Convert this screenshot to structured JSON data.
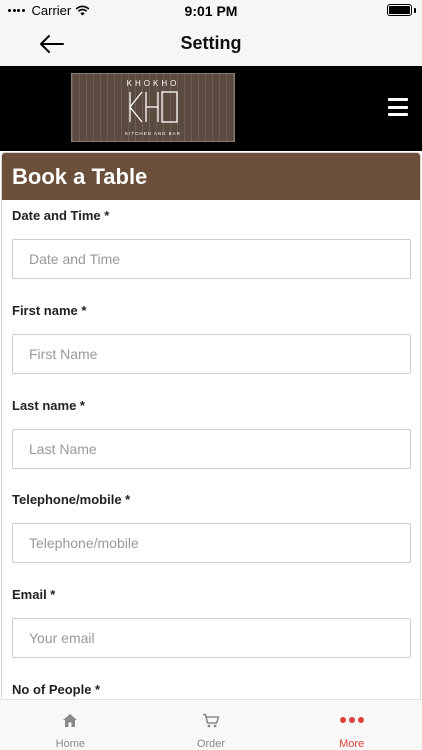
{
  "status_bar": {
    "carrier": "Carrier",
    "time": "9:01 PM"
  },
  "nav": {
    "title": "Setting",
    "back_icon": "back-arrow-icon"
  },
  "brand": {
    "logo_word": "KHOKHO",
    "logo_sub": "KITCHEN AND BAR",
    "menu_icon": "hamburger-menu-icon"
  },
  "form": {
    "title": "Book a Table",
    "fields": [
      {
        "label": "Date and Time *",
        "placeholder": "Date and Time"
      },
      {
        "label": "First name *",
        "placeholder": "First Name"
      },
      {
        "label": "Last name *",
        "placeholder": "Last Name"
      },
      {
        "label": "Telephone/mobile *",
        "placeholder": "Telephone/mobile"
      },
      {
        "label": "Email *",
        "placeholder": "Your email"
      },
      {
        "label": "No of People *",
        "placeholder": ""
      }
    ]
  },
  "tabs": [
    {
      "label": "Home",
      "icon": "home-icon"
    },
    {
      "label": "Order",
      "icon": "cart-icon"
    },
    {
      "label": "More",
      "icon": "more-dots-icon"
    }
  ],
  "colors": {
    "header_brown": "#6b4f3b",
    "brand_bar": "#000000",
    "active_tab": "#e0423a"
  }
}
